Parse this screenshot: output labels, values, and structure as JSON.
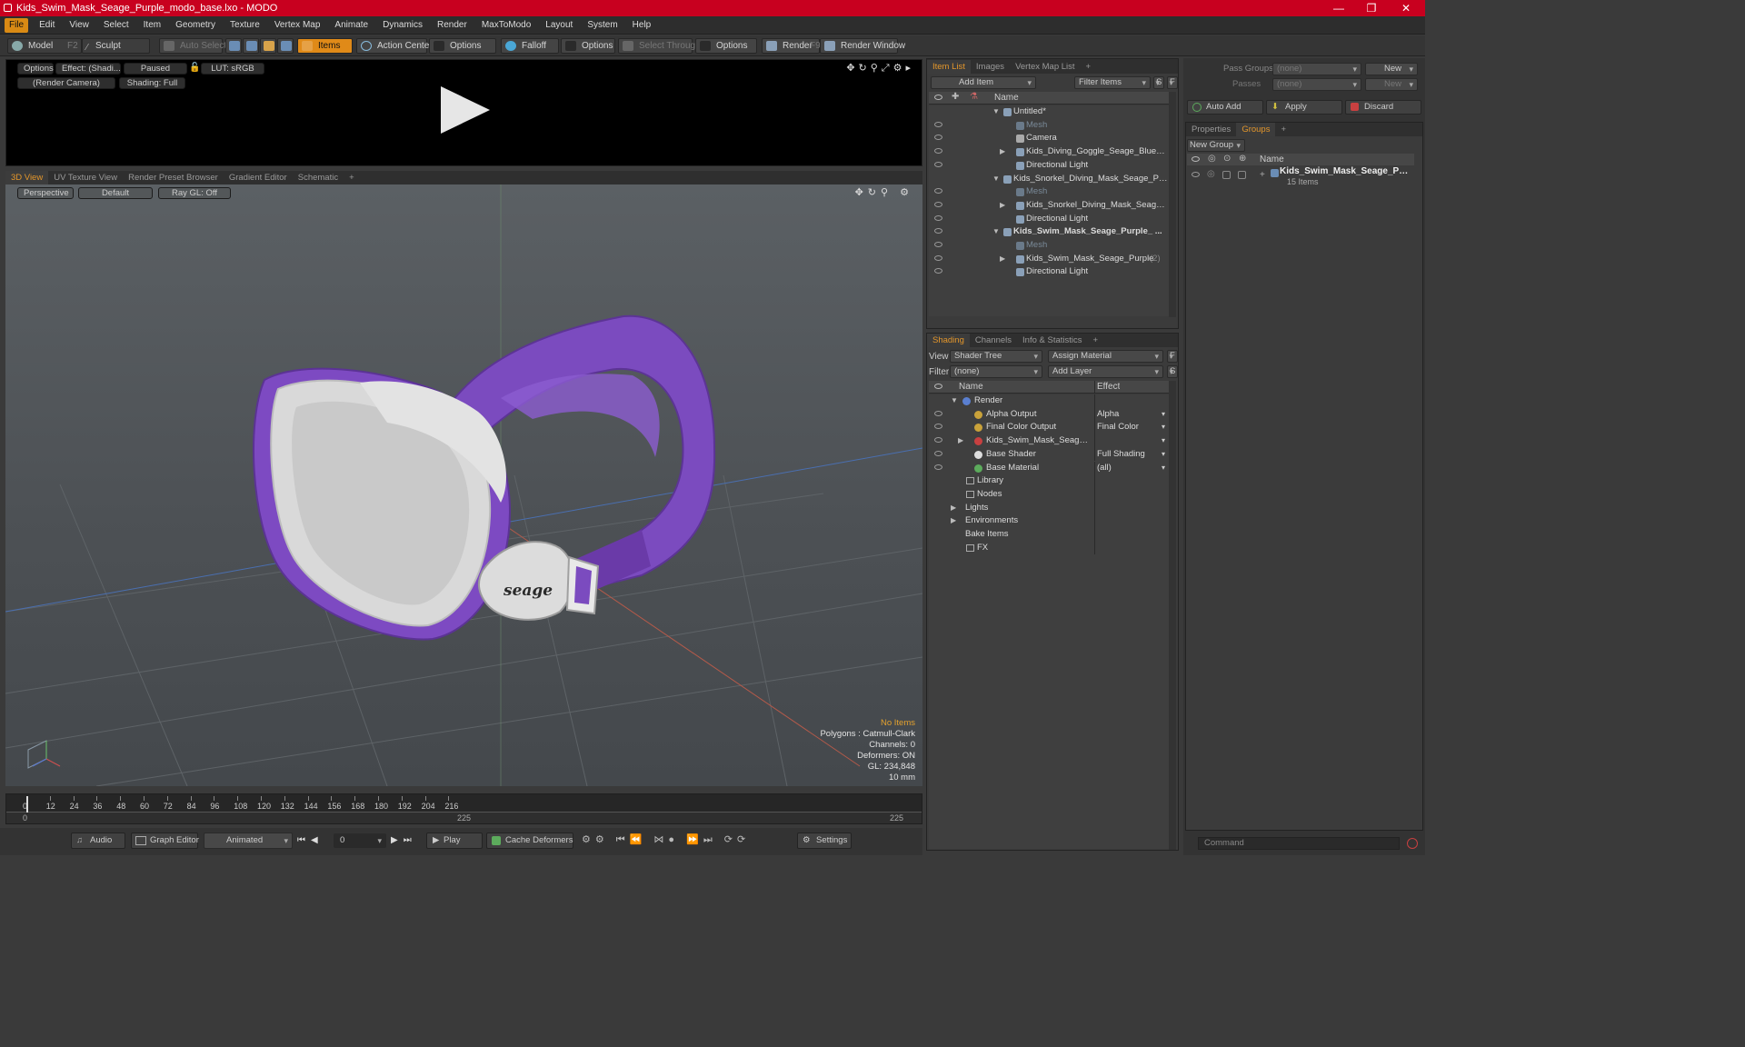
{
  "window": {
    "title": "Kids_Swim_Mask_Seage_Purple_modo_base.lxo - MODO",
    "minimize": "—",
    "maximize": "❐",
    "close": "✕"
  },
  "menu": [
    "File",
    "Edit",
    "View",
    "Select",
    "Item",
    "Geometry",
    "Texture",
    "Vertex Map",
    "Animate",
    "Dynamics",
    "Render",
    "MaxToModo",
    "Layout",
    "System",
    "Help"
  ],
  "toolbar": {
    "model": "Model",
    "model_key": "F2",
    "sculpt": "Sculpt",
    "auto_select": "Auto Select",
    "items": "Items",
    "action_center": "Action Center",
    "options1": "Options",
    "falloff": "Falloff",
    "options2": "Options",
    "select_through": "Select Through",
    "options3": "Options",
    "render": "Render",
    "render_key": "F9",
    "render_window": "Render Window"
  },
  "preview": {
    "options": "Options",
    "effect": "Effect: (Shadi...",
    "paused": "Paused",
    "lut": "LUT: sRGB",
    "camera": "(Render Camera)",
    "shading": "Shading: Full"
  },
  "viewport_tabs": [
    "3D View",
    "UV Texture View",
    "Render Preset Browser",
    "Gradient Editor",
    "Schematic",
    "+"
  ],
  "viewport": {
    "perspective": "Perspective",
    "default": "Default",
    "raygl": "Ray GL: Off",
    "logo_text": "seage",
    "info": {
      "no_items": "No Items",
      "polygons": "Polygons : Catmull-Clark",
      "channels": "Channels: 0",
      "deformers": "Deformers: ON",
      "gl": "GL: 234,848",
      "unit": "10 mm"
    }
  },
  "timeline": {
    "ticks": [
      "0",
      "12",
      "24",
      "36",
      "48",
      "60",
      "72",
      "84",
      "96",
      "108",
      "120",
      "132",
      "144",
      "156",
      "168",
      "180",
      "192",
      "204",
      "216"
    ],
    "start": "0",
    "mid": "225",
    "end": "225"
  },
  "bottom": {
    "audio": "Audio",
    "graph_editor": "Graph Editor",
    "animated": "Animated",
    "frame": "0",
    "play": "Play",
    "cache": "Cache Deformers",
    "settings": "Settings"
  },
  "item_list": {
    "tabs": [
      "Item List",
      "Images",
      "Vertex Map List",
      "+"
    ],
    "add_item": "Add Item",
    "filter_items": "Filter Items",
    "s": "S",
    "f": "F",
    "col_name": "Name",
    "rows": [
      {
        "label": "Untitled*",
        "indent": 0,
        "bold": false,
        "dim": false,
        "eye": false,
        "arrow": "▼"
      },
      {
        "label": "Mesh",
        "indent": 2,
        "bold": false,
        "dim": true,
        "eye": true,
        "arrow": ""
      },
      {
        "label": "Camera",
        "indent": 2,
        "bold": false,
        "dim": false,
        "eye": true,
        "arrow": ""
      },
      {
        "label": "Kids_Diving_Goggle_Seage_Blue_on_...",
        "indent": 2,
        "bold": false,
        "dim": false,
        "eye": true,
        "arrow": "▶"
      },
      {
        "label": "Directional Light",
        "indent": 2,
        "bold": false,
        "dim": false,
        "eye": true,
        "arrow": ""
      },
      {
        "label": "Kids_Snorkel_Diving_Mask_Seage_Purpl ...",
        "indent": 0,
        "bold": false,
        "dim": false,
        "eye": false,
        "arrow": "▼"
      },
      {
        "label": "Mesh",
        "indent": 2,
        "bold": false,
        "dim": true,
        "eye": true,
        "arrow": ""
      },
      {
        "label": "Kids_Snorkel_Diving_Mask_Seage_Pur...",
        "indent": 2,
        "bold": false,
        "dim": false,
        "eye": true,
        "arrow": "▶"
      },
      {
        "label": "Directional Light",
        "indent": 2,
        "bold": false,
        "dim": false,
        "eye": true,
        "arrow": ""
      },
      {
        "label": "Kids_Swim_Mask_Seage_Purple_ ...",
        "indent": 0,
        "bold": true,
        "dim": false,
        "eye": true,
        "arrow": "▼"
      },
      {
        "label": "Mesh",
        "indent": 2,
        "bold": false,
        "dim": true,
        "eye": true,
        "arrow": ""
      },
      {
        "label": "Kids_Swim_Mask_Seage_Purple",
        "suffix": "(2)",
        "indent": 2,
        "bold": false,
        "dim": false,
        "eye": true,
        "arrow": "▶"
      },
      {
        "label": "Directional Light",
        "indent": 2,
        "bold": false,
        "dim": false,
        "eye": true,
        "arrow": ""
      }
    ]
  },
  "shading": {
    "tabs": [
      "Shading",
      "Channels",
      "Info & Statistics",
      "+"
    ],
    "view_label": "View",
    "view_value": "Shader Tree",
    "assign_material": "Assign Material",
    "filter_label": "Filter",
    "filter_value": "(none)",
    "add_layer": "Add Layer",
    "f": "F",
    "s": "S",
    "col_name": "Name",
    "col_effect": "Effect",
    "rows": [
      {
        "label": "Render",
        "effect": "",
        "indent": 0,
        "eye": false,
        "arrow": "▼",
        "color": "#5a7fd0"
      },
      {
        "label": "Alpha Output",
        "effect": "Alpha",
        "indent": 1,
        "eye": true,
        "arrow": "",
        "color": "#c9a23a"
      },
      {
        "label": "Final Color Output",
        "effect": "Final Color",
        "indent": 1,
        "eye": true,
        "arrow": "",
        "color": "#c9a23a"
      },
      {
        "label": "Kids_Swim_Mask_Seage_P ...",
        "effect": "",
        "indent": 1,
        "eye": true,
        "arrow": "▶",
        "color": "#c84040"
      },
      {
        "label": "Base Shader",
        "effect": "Full Shading",
        "indent": 1,
        "eye": true,
        "arrow": "",
        "color": "#dddddd"
      },
      {
        "label": "Base Material",
        "effect": "(all)",
        "indent": 1,
        "eye": true,
        "arrow": "",
        "color": "#5cab5c"
      },
      {
        "label": "Library",
        "effect": "",
        "indent": 0,
        "eye": false,
        "arrow": "",
        "color": ""
      },
      {
        "label": "Nodes",
        "effect": "",
        "indent": 0,
        "eye": false,
        "arrow": "",
        "color": ""
      },
      {
        "label": "Lights",
        "effect": "",
        "indent": -1,
        "eye": false,
        "arrow": "▶",
        "color": ""
      },
      {
        "label": "Environments",
        "effect": "",
        "indent": -1,
        "eye": false,
        "arrow": "▶",
        "color": ""
      },
      {
        "label": "Bake Items",
        "effect": "",
        "indent": -1,
        "eye": false,
        "arrow": "",
        "color": ""
      },
      {
        "label": "FX",
        "effect": "",
        "indent": 0,
        "eye": false,
        "arrow": "",
        "color": ""
      }
    ]
  },
  "pass_groups": {
    "pass_groups_label": "Pass Groups",
    "pass_groups_value": "(none)",
    "passes_label": "Passes",
    "passes_value": "(none)",
    "new1": "New",
    "new2": "New"
  },
  "actions": {
    "auto_add": "Auto Add",
    "apply": "Apply",
    "discard": "Discard"
  },
  "groups": {
    "tabs": [
      "Properties",
      "Groups",
      "+"
    ],
    "new_group": "New Group",
    "col_name": "Name",
    "item_name": "Kids_Swim_Mask_Seage_Pur...",
    "item_count": "15 Items"
  },
  "command": {
    "placeholder": "Command"
  }
}
